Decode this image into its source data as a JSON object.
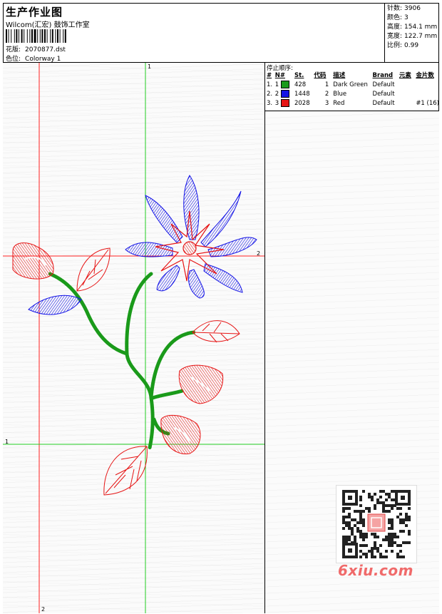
{
  "header": {
    "title": "生产作业图",
    "subtitle": "Wilcom(汇宏) 鼓饰工作室",
    "pattern_label": "花版:",
    "pattern_value": "2070877.dst",
    "colorway_label": "色位:",
    "colorway_value": "Colorway 1"
  },
  "stats": [
    {
      "label": "针数:",
      "value": "3906"
    },
    {
      "label": "颜色:",
      "value": "3"
    },
    {
      "label": "高度:",
      "value": "154.1 mm"
    },
    {
      "label": "宽度:",
      "value": "122.7 mm"
    },
    {
      "label": "比例:",
      "value": "0.99"
    }
  ],
  "stops": {
    "title": "停止顺序:",
    "headers": [
      "#",
      "N#",
      "St.",
      "代码",
      "描述",
      "Brand",
      "元素",
      "金片数"
    ],
    "rows": [
      {
        "num": "1.",
        "n": "1",
        "color": "#1a9a1a",
        "st": "428",
        "code": "1",
        "desc": "Dark Green",
        "brand": "Default",
        "element": "",
        "sequins": ""
      },
      {
        "num": "2.",
        "n": "2",
        "color": "#1414e6",
        "st": "1448",
        "code": "2",
        "desc": "Blue",
        "brand": "Default",
        "element": "",
        "sequins": ""
      },
      {
        "num": "3.",
        "n": "3",
        "color": "#e61414",
        "st": "2028",
        "code": "3",
        "desc": "Red",
        "brand": "Default",
        "element": "",
        "sequins": "#1 (16)"
      }
    ]
  },
  "guides": {
    "v_green": "1",
    "h_red": "2",
    "h_green": "1",
    "v_red": "2"
  },
  "watermark": "6xiu.com",
  "colors": {
    "green": "#1a9a1a",
    "blue": "#1414e6",
    "red": "#e61414",
    "guide_green": "#22cc22",
    "guide_red": "#ff2020"
  }
}
